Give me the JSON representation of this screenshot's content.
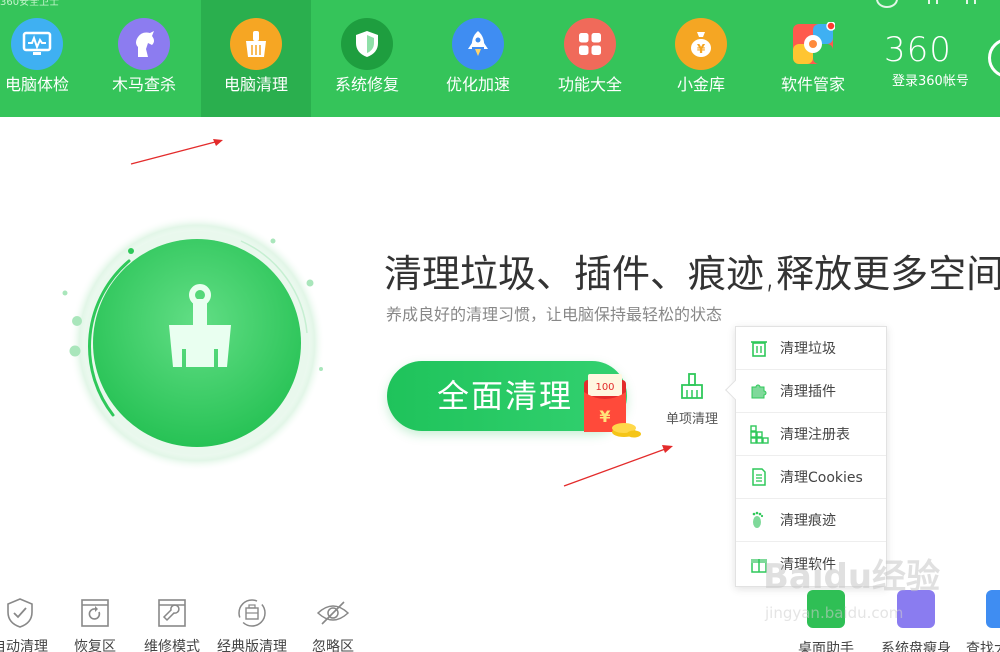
{
  "app": {
    "title_fragment": "360安全卫士"
  },
  "colors": {
    "brand_green": "#35c45a",
    "active_green": "#2aaf4e",
    "accent_red": "#e32b2b"
  },
  "nav": {
    "items": [
      {
        "label": "电脑体检",
        "icon": "monitor-check-icon",
        "color": "#3fb0f2"
      },
      {
        "label": "木马查杀",
        "icon": "horse-icon",
        "color": "#8c7cf0"
      },
      {
        "label": "电脑清理",
        "icon": "broom-icon",
        "color": "#f6a623",
        "active": true
      },
      {
        "label": "系统修复",
        "icon": "shield-icon",
        "color": "#1e9e3f"
      },
      {
        "label": "优化加速",
        "icon": "rocket-icon",
        "color": "#3f8df2"
      },
      {
        "label": "功能大全",
        "icon": "grid-icon",
        "color": "#f06a5a"
      },
      {
        "label": "小金库",
        "icon": "money-bag-icon",
        "color": "#f5a623"
      },
      {
        "label": "软件管家",
        "icon": "app-store-icon",
        "color": "#f0f0f0"
      }
    ]
  },
  "brand": {
    "logo": "360",
    "login_label": "登录360帐号"
  },
  "hero": {
    "headline": "清理垃圾、插件、痕迹,释放更多空间",
    "subline": "养成良好的清理习惯，让电脑保持最轻松的状态",
    "main_button": "全面清理",
    "redpack_amount": "100",
    "redpack_symbol": "¥",
    "single_clean_label": "单项清理"
  },
  "dropdown": {
    "items": [
      {
        "label": "清理垃圾",
        "icon": "trash-icon"
      },
      {
        "label": "清理插件",
        "icon": "puzzle-icon"
      },
      {
        "label": "清理注册表",
        "icon": "registry-icon"
      },
      {
        "label": "清理Cookies",
        "icon": "document-icon"
      },
      {
        "label": "清理痕迹",
        "icon": "footprint-icon"
      },
      {
        "label": "清理软件",
        "icon": "gift-icon"
      }
    ]
  },
  "bottom_tools": [
    {
      "label": "自动清理",
      "icon": "shield-check-icon"
    },
    {
      "label": "恢复区",
      "icon": "restore-icon"
    },
    {
      "label": "维修模式",
      "icon": "wrench-icon"
    },
    {
      "label": "经典版清理",
      "icon": "classic-icon"
    },
    {
      "label": "忽略区",
      "icon": "eye-off-icon"
    }
  ],
  "right_tools": [
    {
      "label": "桌面助手",
      "icon": "desktop-helper-icon",
      "color": "#2fbf55"
    },
    {
      "label": "系统盘瘦身",
      "icon": "disk-slim-icon",
      "color": "#8a7cf0"
    },
    {
      "label": "查找大",
      "icon": "find-large-icon",
      "color": "#3f8df2"
    }
  ],
  "watermark": {
    "text": "Baidu经验",
    "sub": "jingyan.baidu.com"
  }
}
